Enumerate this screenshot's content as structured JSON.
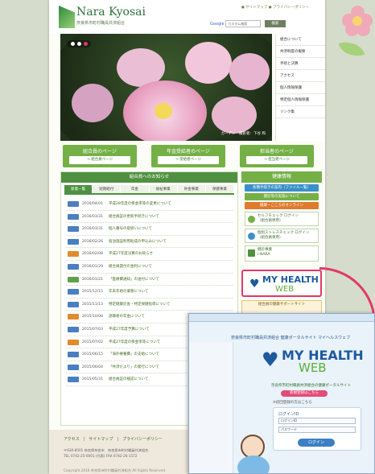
{
  "header": {
    "brand": "Nara Kyosai",
    "subtitle": "奈良県市町村職員共済組合",
    "top_links": "● サイトマップ ● プライバシーポリシー",
    "search_label_google": "Google",
    "search_label_rest": "カスタム検索",
    "search_placeholder": "",
    "search_button": "検索"
  },
  "hero": {
    "caption": "ガーデン　撮影者：下谷 和"
  },
  "side_nav": [
    "組合について",
    "共済制度の概要",
    "手続と決算",
    "アクセス",
    "個人情報保護",
    "特定個人情報保護",
    "リンク集"
  ],
  "portal_buttons": [
    {
      "title": "組合員のページ",
      "link": "→ 組合員ページ"
    },
    {
      "title": "年金受給者のページ",
      "link": "→ 受給者ページ"
    },
    {
      "title": "担当者のページ",
      "link": "→ 担当者ページ"
    }
  ],
  "news": {
    "heading": "組合員へのお知らせ",
    "tabs": [
      "新着一覧",
      "短期給付",
      "年金",
      "福祉事業",
      "貯金事業",
      "保健事業"
    ],
    "items": [
      {
        "date": "2016/04/01",
        "title": "平成28年度の掛金率等の変更について"
      },
      {
        "date": "2016/03/31",
        "title": "組合員証の更新手続きについて"
      },
      {
        "date": "2016/03/31",
        "title": "個人番号の取扱いについて"
      },
      {
        "date": "2016/02/26",
        "title": "宿泊施設利用助成の申込みについて"
      },
      {
        "date": "2016/02/08",
        "title": "平成27年度決算のお知らせ"
      },
      {
        "date": "2016/01/29",
        "title": "組合員貸付の金利について"
      },
      {
        "date": "2016/01/21",
        "title": "「医療費通知」の送付について"
      },
      {
        "date": "2015/12/15",
        "title": "年末年始の業務について"
      },
      {
        "date": "2015/11/13",
        "title": "特定健康診査・特定保健指導について"
      },
      {
        "date": "2015/10/08",
        "title": "退職者の年金について"
      },
      {
        "date": "2015/07/03",
        "title": "平成27年度予算について"
      },
      {
        "date": "2015/07/02",
        "title": "平成27年度の掛金率等について"
      },
      {
        "date": "2015/06/15",
        "title": "「海外療養費」の支給について"
      },
      {
        "date": "2015/06/04",
        "title": "「共済だより」の発行について"
      },
      {
        "date": "2015/05/31",
        "title": "組合員証の検認について"
      }
    ],
    "badge_colors": [
      "#4a7fc0",
      "#4a7fc0",
      "#4a7fc0",
      "#4a7fc0",
      "#e08c2c",
      "#4a7fc0",
      "#5fa14a",
      "#4a7fc0",
      "#4a7fc0",
      "#e08c2c",
      "#4a7fc0",
      "#e08c2c",
      "#4a7fc0",
      "#4a7fc0",
      "#4a7fc0"
    ]
  },
  "sidebar": {
    "heading": "健康情報",
    "buttons": [
      "各種手続きの案内（ファイル一覧）",
      "健診等の実施について",
      "健康・こころのオンライン"
    ],
    "cards": [
      {
        "line1": "セルフチェック ログイン",
        "line2": "（組合員専用）"
      },
      {
        "line1": "個別ストレスチェック ログイン",
        "line2": "（組合員専用）"
      },
      {
        "line1": "健診事業",
        "line2": "I-NARA"
      }
    ],
    "health_web_1": "MY HEALTH",
    "health_web_2": "WEB",
    "banner_extra_1": "組合員の健康サポートサイト",
    "banner_extra_2": "組合員専用ページ"
  },
  "footer": {
    "links": "アクセス　|　サイトマップ　|　プライバシーポリシー",
    "address_1": "〒630-8501 奈良県奈良市　奈良県市町村職員共済組合",
    "address_2": "TEL 0742-25-0001 (代表) FAX 0742-26-1572",
    "copyright": "Copyright 2016 奈良県市町村職員共済組合 All Rights Reserved."
  },
  "popup": {
    "title": "奈良県市町村職員共済組合 健康ポータルサイト マイヘルスウェブ",
    "logo_1": "MY HEALTH",
    "logo_2": "WEB",
    "tagline": "奈良県市町村職員共済組合の健康ポータルサイト",
    "register_button": "新規登録はこちら",
    "note": "※初回登録の方はこちら",
    "login_title": "ログインID",
    "id_placeholder": "ログインID",
    "pw_placeholder": "パスワード",
    "login_button": "ログイン"
  },
  "colors": {
    "green": "#75b046",
    "dark_green": "#4f9140",
    "pink": "#e03a69",
    "blue": "#1d5a9e"
  }
}
